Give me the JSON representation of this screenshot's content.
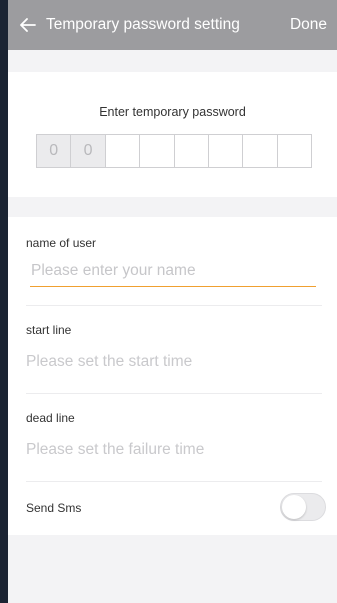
{
  "header": {
    "title": "Temporary password setting",
    "done_label": "Done"
  },
  "password": {
    "label": "Enter temporary password",
    "digits": [
      "0",
      "0",
      "",
      "",
      "",
      "",
      "",
      ""
    ]
  },
  "form": {
    "user_name": {
      "label": "name of user",
      "placeholder": "Please enter your name"
    },
    "start_line": {
      "label": "start line",
      "placeholder": "Please set the start time"
    },
    "dead_line": {
      "label": "dead line",
      "placeholder": "Please set the failure time"
    },
    "send_sms": {
      "label": "Send Sms",
      "enabled": false
    }
  },
  "colors": {
    "header_bg": "#9c9c9f",
    "accent_underline": "#f0a030"
  }
}
